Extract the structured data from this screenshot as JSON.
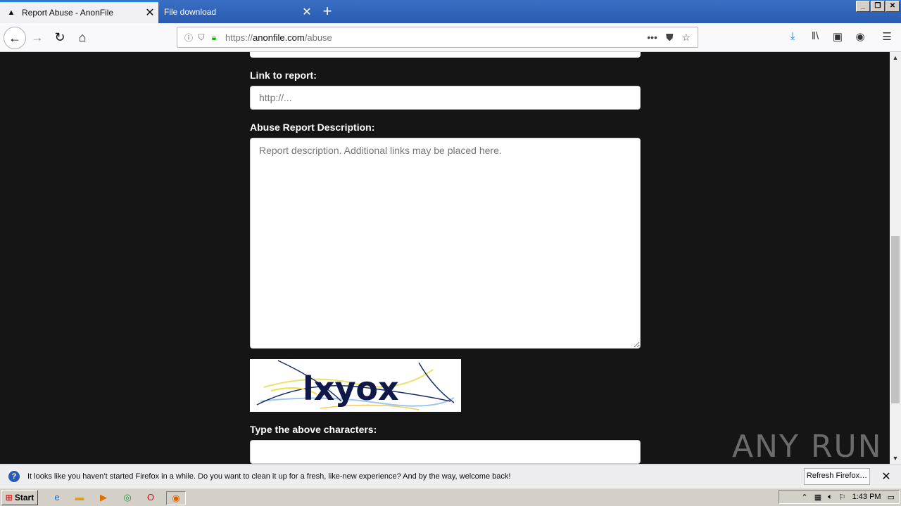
{
  "tabs": [
    {
      "title": "Report Abuse - AnonFile",
      "active": true
    },
    {
      "title": "File download",
      "active": false
    }
  ],
  "window_buttons": [
    "_",
    "❐",
    "✕"
  ],
  "nav": {
    "url_prefix": "https://",
    "url_domain": "anonfile.com",
    "url_path": "/abuse"
  },
  "form": {
    "link_label": "Link to report:",
    "link_placeholder": "http://...",
    "description_label": "Abuse Report Description:",
    "description_placeholder": "Report description. Additional links may be placed here.",
    "captcha_text": "lxyox",
    "captcha_label": "Type the above characters:"
  },
  "watermark": "ANY RUN",
  "notification": {
    "message": "It looks like you haven’t started Firefox in a while. Do you want to clean it up for a fresh, like-new experience? And by the way, welcome back!",
    "button": "Refresh Firefox…"
  },
  "taskbar": {
    "start": "Start",
    "clock": "1:43 PM"
  },
  "colors": {
    "page_bg": "#151515",
    "accent": "#0a84ff",
    "tabbar": "#2a5bb0"
  }
}
